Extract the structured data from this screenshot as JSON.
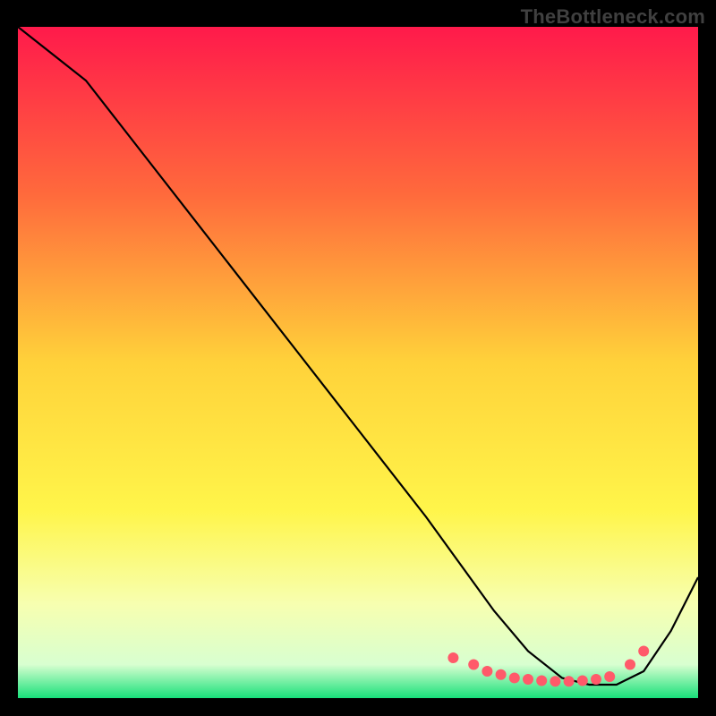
{
  "watermark": "TheBottleneck.com",
  "chart_data": {
    "type": "line",
    "title": "",
    "xlabel": "",
    "ylabel": "",
    "xlim": [
      0,
      100
    ],
    "ylim": [
      0,
      100
    ],
    "grid": false,
    "legend": false,
    "background_gradient": {
      "stops": [
        {
          "pos": 0.0,
          "color": "#ff1a4b"
        },
        {
          "pos": 0.25,
          "color": "#ff6a3c"
        },
        {
          "pos": 0.5,
          "color": "#ffd23a"
        },
        {
          "pos": 0.72,
          "color": "#fff54a"
        },
        {
          "pos": 0.86,
          "color": "#f7ffb0"
        },
        {
          "pos": 0.95,
          "color": "#d8ffd0"
        },
        {
          "pos": 1.0,
          "color": "#18e07a"
        }
      ]
    },
    "series": [
      {
        "name": "bottleneck-curve",
        "color": "#000000",
        "x": [
          0,
          5,
          10,
          20,
          30,
          40,
          50,
          60,
          65,
          70,
          75,
          80,
          84,
          88,
          92,
          96,
          100
        ],
        "y": [
          100,
          96,
          92,
          79,
          66,
          53,
          40,
          27,
          20,
          13,
          7,
          3,
          2,
          2,
          4,
          10,
          18
        ]
      }
    ],
    "highlight_points": {
      "name": "optimal-zone-dots",
      "color": "#ff5a6a",
      "x": [
        64,
        67,
        69,
        71,
        73,
        75,
        77,
        79,
        81,
        83,
        85,
        87,
        90,
        92
      ],
      "y": [
        6,
        5,
        4,
        3.5,
        3,
        2.8,
        2.6,
        2.5,
        2.5,
        2.6,
        2.8,
        3.2,
        5,
        7
      ]
    }
  }
}
